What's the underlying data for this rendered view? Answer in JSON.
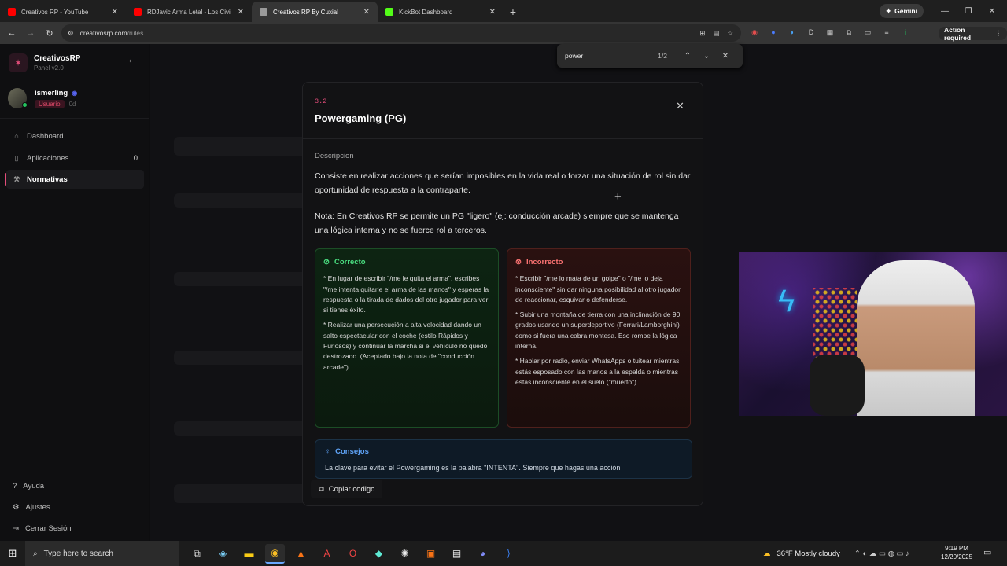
{
  "browser": {
    "tabs": [
      {
        "title": "Creativos RP - YouTube",
        "color": "#ff0000"
      },
      {
        "title": "RDJavic Arma Letal - Los Civiles",
        "color": "#ff0000"
      },
      {
        "title": "Creativos RP By Cuxial",
        "color": "#b0b0b0"
      },
      {
        "title": "KickBot Dashboard",
        "color": "#53fc18"
      }
    ],
    "gemini_label": "Gemini",
    "url_host": "creativosrp.com",
    "url_path": "/rules",
    "action_required": "Action required"
  },
  "find": {
    "query": "power",
    "count": "1/2"
  },
  "sidebar": {
    "brand_name": "CreativosRP",
    "brand_sub": "Panel v2.0",
    "user_name": "ismerling",
    "user_role": "Usuario",
    "user_days": "0d",
    "nav": [
      {
        "label": "Dashboard",
        "icon": "home-icon"
      },
      {
        "label": "Aplicaciones",
        "icon": "file-icon",
        "count": "0"
      },
      {
        "label": "Normativas",
        "icon": "gavel-icon"
      }
    ],
    "bottom": [
      {
        "label": "Ayuda",
        "icon": "help-icon"
      },
      {
        "label": "Ajustes",
        "icon": "gear-icon"
      },
      {
        "label": "Cerrar Sesión",
        "icon": "logout-icon"
      }
    ]
  },
  "modal": {
    "number": "3.2",
    "title": "Powergaming (PG)",
    "desc_label": "Descripcion",
    "desc": "Consiste en realizar acciones que serían imposibles en la vida real o forzar una situación de rol sin dar oportunidad de respuesta a la contraparte.",
    "note": "Nota: En Creativos RP se permite un PG \"ligero\" (ej: conducción arcade) siempre que se mantenga una lógica interna y no se fuerce rol a terceros.",
    "correct_title": "Correcto",
    "correct_items": [
      "* En lugar de escribir \"/me le quita el arma\", escribes \"/me intenta quitarle el arma de las manos\" y esperas la respuesta o la tirada de dados del otro jugador para ver si tienes éxito.",
      "* Realizar una persecución a alta velocidad dando un salto espectacular con el coche (estilo Rápidos y Furiosos) y continuar la marcha si el vehículo no quedó destrozado. (Aceptado bajo la nota de \"conducción arcade\")."
    ],
    "incorrect_title": "Incorrecto",
    "incorrect_items": [
      "* Escribir \"/me lo mata de un golpe\" o \"/me lo deja inconsciente\" sin dar ninguna posibilidad al otro jugador de reaccionar, esquivar o defenderse.",
      "* Subir una montaña de tierra con una inclinación de 90 grados usando un superdeportivo (Ferrari/Lamborghini) como si fuera una cabra montesa. Eso rompe la lógica interna.",
      "* Hablar por radio, enviar WhatsApps o tuitear mientras estás esposado con las manos a la espalda o mientras estás inconsciente en el suelo (\"muerto\")."
    ],
    "tips_title": "Consejos",
    "tips_text": "La clave para evitar el Powergaming es la palabra \"INTENTA\". Siempre que hagas una acción",
    "copy_label": "Copiar codigo"
  },
  "taskbar": {
    "search_placeholder": "Type here to search",
    "weather": "36°F  Mostly cloudy",
    "time": "9:19 PM",
    "date": "12/20/2025"
  }
}
